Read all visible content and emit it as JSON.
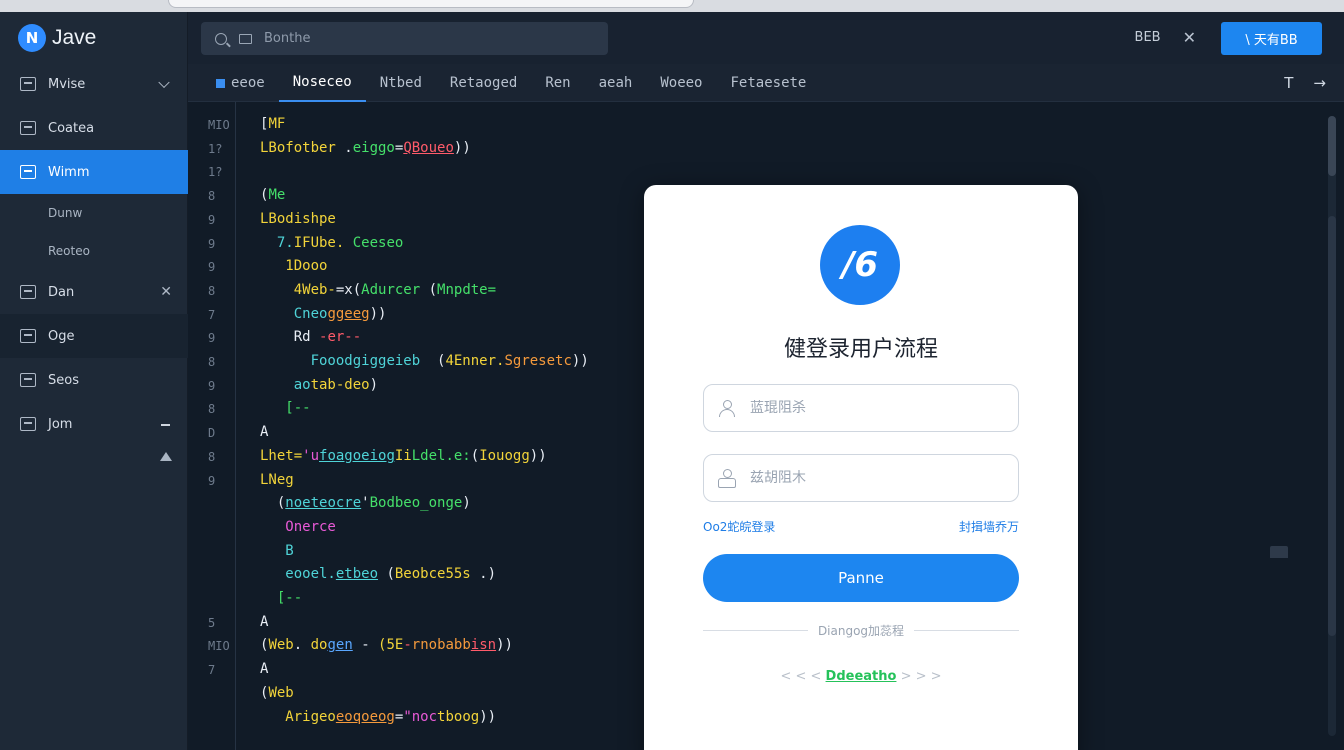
{
  "app": {
    "name": "Jave",
    "logo_glyph": "N"
  },
  "sidebar": {
    "items": [
      {
        "label": "Mvise",
        "icon": "list-icon",
        "trailing": "chevron-down-icon"
      },
      {
        "label": "Coatea",
        "icon": "edit-icon"
      },
      {
        "label": "Wimm",
        "icon": "grid-icon",
        "active": true
      },
      {
        "label": "Dunw",
        "sub": true
      },
      {
        "label": "Reoteo",
        "sub": true
      },
      {
        "label": "Dan",
        "icon": "table-icon",
        "trailing": "close-icon"
      },
      {
        "label": "Oge",
        "icon": "chart-icon"
      },
      {
        "label": "Seos",
        "icon": "doc-icon"
      },
      {
        "label": "Jom",
        "icon": "window-icon",
        "trailing": "dash-icon"
      }
    ]
  },
  "header": {
    "search_text": "Bonthe",
    "tool_label": "BEB",
    "login_button": "\\ 天有BB"
  },
  "tabs": {
    "items": [
      {
        "label": "eeoe",
        "active": false,
        "has_icon": true
      },
      {
        "label": "Noseceo",
        "active": true
      },
      {
        "label": "Ntbed"
      },
      {
        "label": "Retaoged"
      },
      {
        "label": "Ren"
      },
      {
        "label": "aeah"
      },
      {
        "label": "Woeeo"
      },
      {
        "label": "Fetaesete"
      }
    ],
    "right_icons": [
      "T",
      "→"
    ]
  },
  "code": {
    "line_numbers": [
      "MIO",
      "1?",
      "1?",
      "8",
      "9",
      "9",
      "9",
      "8",
      "7",
      "9",
      "8",
      "9",
      "8",
      "D",
      "8",
      "9",
      "",
      "",
      "",
      "",
      "",
      "5",
      "MIO",
      "7"
    ],
    "lines": [
      [
        {
          "t": "[",
          "c": "w"
        },
        {
          "t": "MF",
          "c": "y"
        }
      ],
      [
        {
          "t": "LBofotber",
          "c": "y"
        },
        {
          "t": " .",
          "c": "w"
        },
        {
          "t": "eiggo",
          "c": "g"
        },
        {
          "t": "=",
          "c": "w"
        },
        {
          "t": "QBoueo",
          "c": "r",
          "u": true
        },
        {
          "t": "))",
          "c": "w"
        }
      ],
      [],
      [
        {
          "t": "(",
          "c": "w"
        },
        {
          "t": "Me",
          "c": "g"
        }
      ],
      [
        {
          "t": "LBodishpe",
          "c": "y"
        }
      ],
      [
        {
          "t": "  7.",
          "c": "c"
        },
        {
          "t": "IFUbe.",
          "c": "y"
        },
        {
          "t": " Ceeseo",
          "c": "g"
        }
      ],
      [
        {
          "t": "   1Dooo",
          "c": "y"
        }
      ],
      [
        {
          "t": "    4Web-",
          "c": "y"
        },
        {
          "t": "=x(",
          "c": "w"
        },
        {
          "t": "Adurcer",
          "c": "g"
        },
        {
          "t": " (",
          "c": "w"
        },
        {
          "t": "Mnpdte=",
          "c": "g"
        }
      ],
      [
        {
          "t": "    Cneo",
          "c": "c"
        },
        {
          "t": "ggeeg",
          "c": "o",
          "u": true
        },
        {
          "t": "))",
          "c": "w"
        }
      ],
      [
        {
          "t": "    Rd ",
          "c": "w"
        },
        {
          "t": "-er--",
          "c": "r"
        }
      ],
      [
        {
          "t": "      Fooo",
          "c": "c"
        },
        {
          "t": "dgiggeieb",
          "c": "c"
        },
        {
          "t": "  (",
          "c": "w"
        },
        {
          "t": "4Enner.",
          "c": "y"
        },
        {
          "t": "Sgresetc",
          "c": "o"
        },
        {
          "t": "))",
          "c": "w"
        }
      ],
      [
        {
          "t": "    ao",
          "c": "c"
        },
        {
          "t": "tab-deo",
          "c": "y"
        },
        {
          "t": ")",
          "c": "w"
        }
      ],
      [
        {
          "t": "   [--",
          "c": "g"
        }
      ],
      [
        {
          "t": "A",
          "c": "w"
        }
      ],
      [
        {
          "t": "Lhet=",
          "c": "y"
        },
        {
          "t": "'u",
          "c": "m"
        },
        {
          "t": "foagoeiog",
          "c": "c",
          "u": true
        },
        {
          "t": "Ii",
          "c": "y"
        },
        {
          "t": "Ldel.e:",
          "c": "g"
        },
        {
          "t": "(",
          "c": "w"
        },
        {
          "t": "Iouogg",
          "c": "y"
        },
        {
          "t": "))",
          "c": "w"
        }
      ],
      [
        {
          "t": "LNeg",
          "c": "y"
        }
      ],
      [
        {
          "t": "  (",
          "c": "w"
        },
        {
          "t": "noeteocre",
          "c": "c",
          "u": true
        },
        {
          "t": "'",
          "c": "w"
        },
        {
          "t": "Bodbeo_onge",
          "c": "g"
        },
        {
          "t": ")",
          "c": "w"
        }
      ],
      [
        {
          "t": "   Onerce",
          "c": "m"
        }
      ],
      [
        {
          "t": "   B",
          "c": "c"
        }
      ],
      [
        {
          "t": "   eooel.",
          "c": "c"
        },
        {
          "t": "etbeo",
          "c": "c",
          "u": true
        },
        {
          "t": " (",
          "c": "w"
        },
        {
          "t": "Beobce55s",
          "c": "y"
        },
        {
          "t": " .)",
          "c": "w"
        }
      ],
      [
        {
          "t": "  [--",
          "c": "g"
        }
      ],
      [
        {
          "t": "A",
          "c": "w"
        }
      ],
      [
        {
          "t": "(",
          "c": "w"
        },
        {
          "t": "Web",
          "c": "y"
        },
        {
          "t": ".",
          "c": "w"
        },
        {
          "t": " do",
          "c": "y"
        },
        {
          "t": "gen",
          "c": "b",
          "u": true
        },
        {
          "t": " -",
          "c": "w"
        },
        {
          "t": " (5E",
          "c": "y"
        },
        {
          "t": "-",
          "c": "r"
        },
        {
          "t": "rnobabb",
          "c": "o"
        },
        {
          "t": "isn",
          "c": "r",
          "u": true
        },
        {
          "t": "))",
          "c": "w"
        }
      ],
      [
        {
          "t": "A",
          "c": "w"
        }
      ],
      [
        {
          "t": "(",
          "c": "w"
        },
        {
          "t": "Web",
          "c": "y"
        }
      ],
      [
        {
          "t": "   Arigeo",
          "c": "y"
        },
        {
          "t": "eoqoeog",
          "c": "o",
          "u": true
        },
        {
          "t": "=",
          "c": "w"
        },
        {
          "t": "\"noc",
          "c": "m"
        },
        {
          "t": "tboog",
          "c": "y"
        },
        {
          "t": "))",
          "c": "w"
        }
      ]
    ]
  },
  "login": {
    "logo_glyph": "/6",
    "title": "健登录用户流程",
    "username_placeholder": "蓝琨阻杀",
    "password_placeholder": "兹胡阻木",
    "left_link": "Oo2蛇皖登录",
    "right_link": "封揖墙乔万",
    "submit": "Panne",
    "divider_text": "Diangog加蕊程",
    "third_left": "< < <",
    "third_link": "Ddeeatho",
    "third_right": "> > >"
  },
  "colors": {
    "accent": "#1d86f0",
    "sidebar_active": "#1f7fe6",
    "editor_bg": "#111b27"
  }
}
